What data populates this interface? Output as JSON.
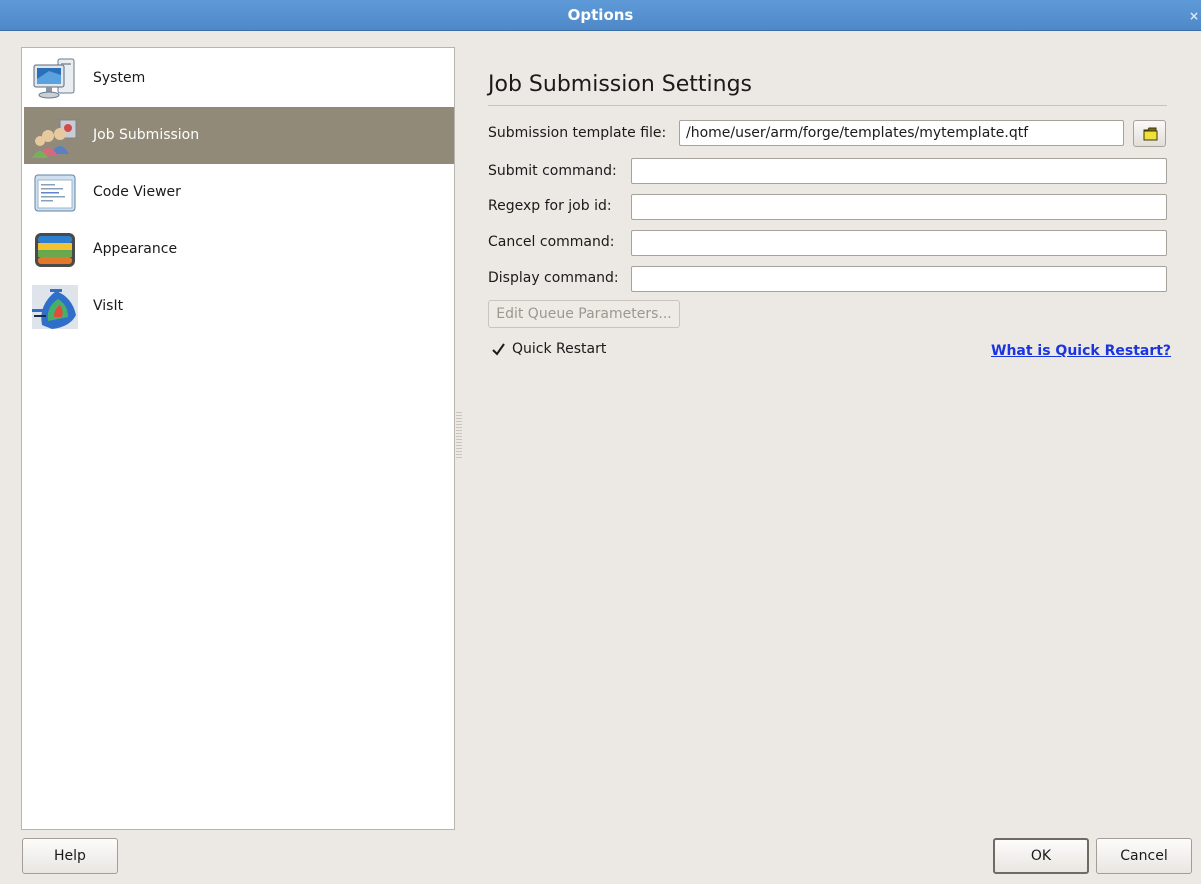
{
  "window": {
    "title": "Options",
    "close_glyph": "×"
  },
  "sidebar": {
    "items": [
      {
        "label": "System",
        "icon": "system-monitor-icon",
        "selected": false
      },
      {
        "label": "Job Submission",
        "icon": "job-submission-users-icon",
        "selected": true
      },
      {
        "label": "Code Viewer",
        "icon": "code-viewer-icon",
        "selected": false
      },
      {
        "label": "Appearance",
        "icon": "appearance-icon",
        "selected": false
      },
      {
        "label": "VisIt",
        "icon": "visit-icon",
        "selected": false
      }
    ]
  },
  "main": {
    "title": "Job Submission Settings",
    "fields": {
      "template_label": "Submission template file:",
      "template_value": "/home/user/arm/forge/templates/mytemplate.qtf",
      "submit_label": "Submit command:",
      "submit_value": "",
      "regexp_label": "Regexp for job id:",
      "regexp_value": "",
      "cancel_label": "Cancel command:",
      "cancel_value": "",
      "display_label": "Display command:",
      "display_value": ""
    },
    "browse_icon": "folder-open-icon",
    "queue_button": "Edit Queue Parameters...",
    "quick_restart": {
      "label": "Quick Restart",
      "checked": true
    },
    "help_link": "What is Quick Restart?"
  },
  "footer": {
    "help": "Help",
    "ok": "OK",
    "cancel": "Cancel"
  },
  "colors": {
    "titlebar": "#5a94d3",
    "selection": "#928a78",
    "background": "#ece9e4",
    "link": "#1a35e0"
  }
}
